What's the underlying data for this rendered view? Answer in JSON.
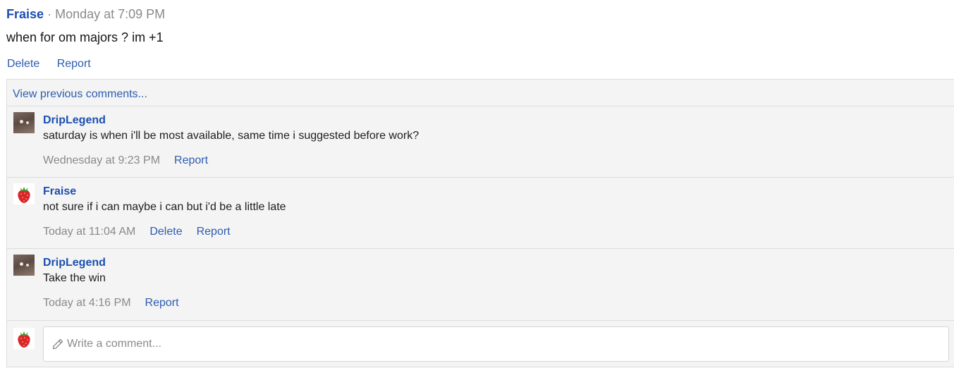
{
  "post": {
    "author": "Fraise",
    "separator": "·",
    "time": "Monday at 7:09 PM",
    "body": "when for om majors ? im +1",
    "actions": {
      "delete": "Delete",
      "report": "Report"
    }
  },
  "comments_section": {
    "view_previous": "View previous comments...",
    "comments": [
      {
        "author": "DripLegend",
        "text": "saturday is when i'll be most available, same time i suggested before work?",
        "time": "Wednesday at 9:23 PM",
        "report": "Report"
      },
      {
        "author": "Fraise",
        "text": "not sure if i can maybe i can but i'd be a little late",
        "time": "Today at 11:04 AM",
        "delete": "Delete",
        "report": "Report"
      },
      {
        "author": "DripLegend",
        "text": "Take the win",
        "time": "Today at 4:16 PM",
        "report": "Report"
      }
    ],
    "composer": {
      "placeholder": "Write a comment...",
      "icon": "pencil-icon"
    }
  },
  "colors": {
    "link": "#2c5cb0",
    "author": "#1b4fb0",
    "muted": "#8a8a8a",
    "panel_bg": "#f4f4f4",
    "border": "#dcdcdc"
  }
}
